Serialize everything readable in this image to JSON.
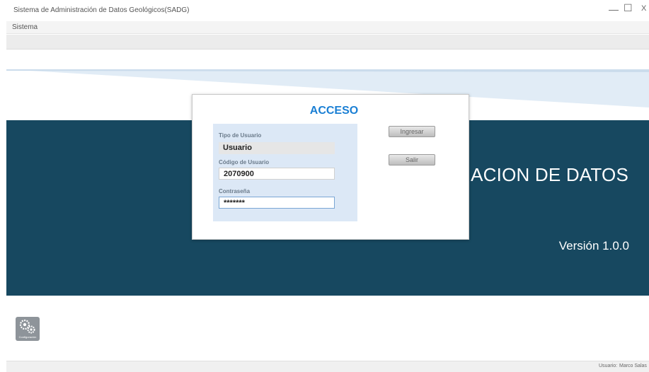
{
  "window": {
    "title": "Sistema de Administración de Datos Geológicos(SADG)",
    "controls": {
      "minimize": "—",
      "maximize": "☐",
      "close": "X"
    }
  },
  "menu": {
    "items": [
      {
        "label": "Sistema"
      }
    ]
  },
  "banner": {
    "title": "ACION DE DATOS",
    "version": "Versión 1.0.0",
    "color": "#174860"
  },
  "login_dialog": {
    "title": "ACCESO",
    "tipo_usuario": {
      "label": "Tipo de Usuario",
      "value": "Usuario"
    },
    "codigo_usuario": {
      "label": "Código de Usuario",
      "value": "2070900"
    },
    "contrasena": {
      "label": "Contraseña",
      "value": "*******"
    },
    "buttons": {
      "ingresar": "Ingresar",
      "salir": "Salir"
    },
    "accent": "#1a7fd4"
  },
  "config": {
    "label": "Configuración",
    "icon": "gears-icon"
  },
  "status": {
    "user_label": "Usuario:",
    "user_name": "Marco Salas"
  }
}
